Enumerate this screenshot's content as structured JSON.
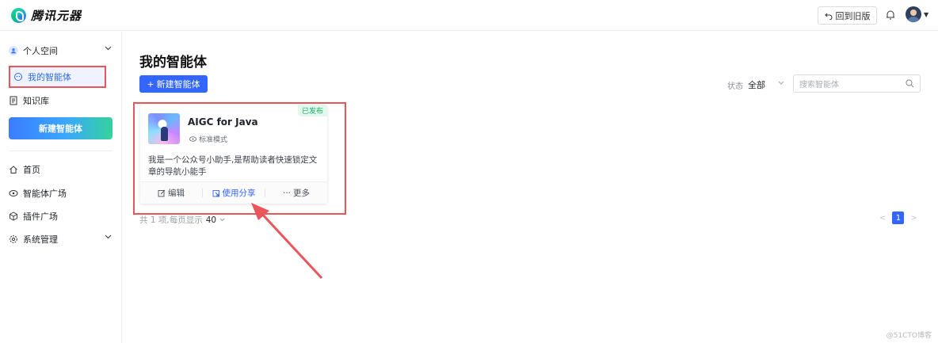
{
  "header": {
    "logo_text": "腾讯元器",
    "back_old_label": "回到旧版"
  },
  "sidebar": {
    "personal_space": "个人空间",
    "my_agents": "我的智能体",
    "knowledge_base": "知识库",
    "new_agent_button": "新建智能体",
    "home": "首页",
    "agent_plaza": "智能体广场",
    "plugin_plaza": "插件广场",
    "system_admin": "系统管理"
  },
  "main": {
    "title": "我的智能体",
    "create_button": "新建智能体",
    "status_label": "状态",
    "status_value": "全部",
    "search_placeholder": "搜索智能体"
  },
  "card": {
    "badge": "已发布",
    "title": "AIGC for Java",
    "mode": "标准模式",
    "description": "我是一个公众号小助手,是帮助读者快速锁定文章的导航小能手",
    "actions": {
      "edit": "编辑",
      "share": "使用分享",
      "more": "更多"
    }
  },
  "pagination": {
    "summary": "共 1 项,每页显示",
    "page_size": "40",
    "current_page": "1"
  },
  "watermark": "@51CTO博客",
  "colors": {
    "accent": "#3366ff",
    "highlight_red": "#e8555a",
    "published_green": "#18b166"
  }
}
